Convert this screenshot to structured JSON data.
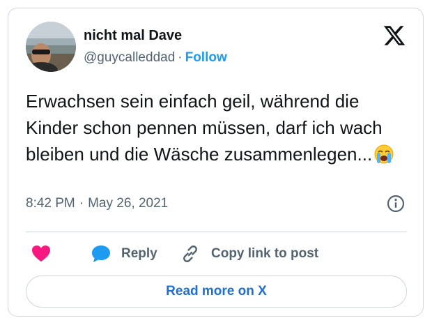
{
  "author": {
    "display_name": "nicht mal Dave",
    "handle": "@guycalleddad",
    "separator": "·",
    "follow_label": "Follow",
    "avatar_icon": "profile-photo"
  },
  "brand": {
    "logo_icon": "x-logo-icon",
    "color": "#0f1419"
  },
  "tweet": {
    "text": "Erwachsen sein einfach geil, während die Kinder schon pennen müssen, darf ich wach bleiben und die Wäsche zusammenlegen...",
    "emoji_icon": "loudly-crying-face-emoji"
  },
  "meta": {
    "time": "8:42 PM",
    "separator": "·",
    "date": "May 26, 2021",
    "info_icon": "info-icon"
  },
  "actions": {
    "like_icon": "heart-icon",
    "reply_label": "Reply",
    "reply_icon": "speech-bubble-icon",
    "copy_label": "Copy link to post",
    "copy_icon": "link-icon"
  },
  "footer": {
    "read_more_label": "Read more on X"
  },
  "colors": {
    "accent": "#1d9bf0",
    "like": "#f91880",
    "secondary_text": "#536471",
    "border": "#cfd9de"
  }
}
